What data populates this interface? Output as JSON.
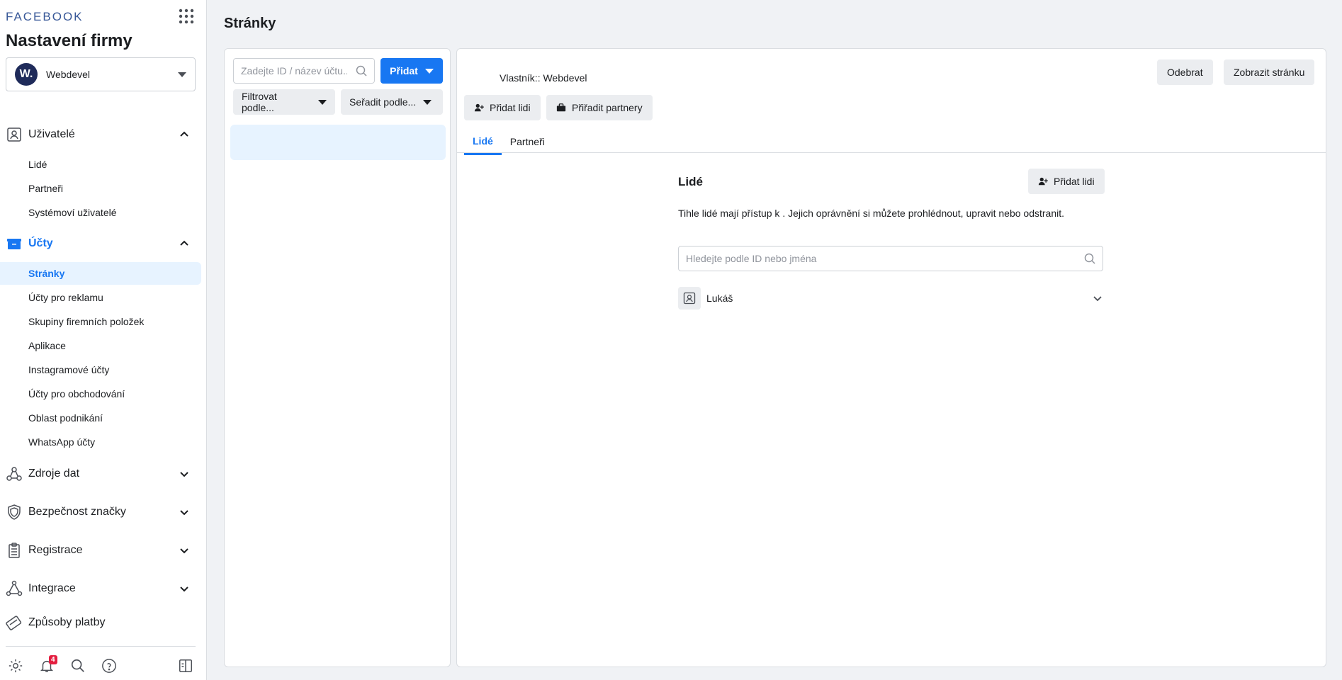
{
  "sidebar": {
    "brand": "FACEBOOK",
    "title": "Nastavení firmy",
    "business": {
      "logo_letter": "W.",
      "name": "Webdevel"
    },
    "groups": {
      "users": "Uživatelé",
      "accounts": "Účty",
      "data_sources": "Zdroje dat",
      "brand_safety": "Bezpečnost značky",
      "registrations": "Registrace",
      "integrations": "Integrace",
      "payments": "Způsoby platby"
    },
    "users_items": [
      "Lidé",
      "Partneři",
      "Systémoví uživatelé"
    ],
    "accounts_items": [
      "Stránky",
      "Účty pro reklamu",
      "Skupiny firemních položek",
      "Aplikace",
      "Instagramové účty",
      "Účty pro obchodování",
      "Oblast podnikání",
      "WhatsApp účty"
    ],
    "notifications_count": "4"
  },
  "main": {
    "page_title": "Stránky",
    "list_panel": {
      "search_placeholder": "Zadejte ID / název účtu...",
      "add_button": "Přidat",
      "filter_button": "Filtrovat podle...",
      "sort_button": "Seřadit podle..."
    },
    "detail": {
      "owner_label": "Vlastník:: Webdevel",
      "remove_button": "Odebrat",
      "view_page_button": "Zobrazit stránku",
      "add_people_button": "Přidat lidi",
      "assign_partners_button": "Přiřadit partnery",
      "tabs": [
        "Lidé",
        "Partneři"
      ],
      "people_section": {
        "title": "Lidé",
        "add_people_button": "Přidat lidi",
        "description": "Tihle lidé mají přístup k            . Jejich oprávnění si můžete prohlédnout, upravit nebo odstranit.",
        "search_placeholder": "Hledejte podle ID nebo jména",
        "people": [
          "Lukáš"
        ]
      }
    }
  },
  "colors": {
    "accent": "#1877f2",
    "selected_bg": "#e7f3ff",
    "button_grey": "#ebedf0"
  }
}
